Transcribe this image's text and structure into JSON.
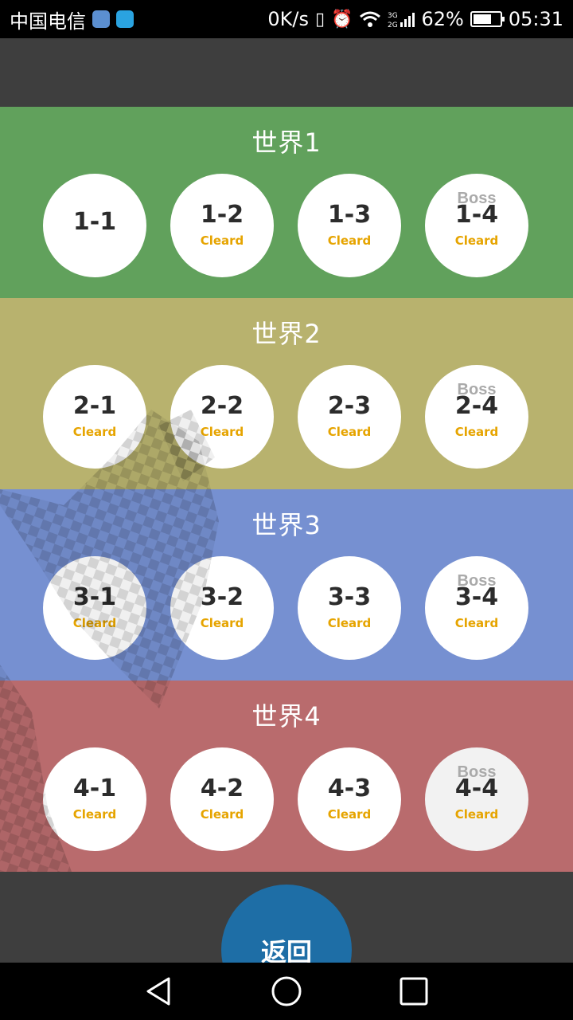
{
  "status_bar": {
    "carrier": "中国电信",
    "net_speed": "0K/s",
    "network": "3G 2G",
    "battery": "62%",
    "time": "05:31",
    "icons": [
      "app-icon",
      "app-icon",
      "vibrate-icon",
      "alarm-icon",
      "wifi-icon",
      "signal-icon",
      "battery-icon"
    ]
  },
  "colors": {
    "world1": "#61a15c",
    "world2": "#b8b26e",
    "world3": "#7690d1",
    "world4": "#b96b6d",
    "cleared_text": "#e6a400",
    "back_button": "#1e6ea6"
  },
  "worlds": [
    {
      "title": "世界1",
      "stages": [
        {
          "label": "1-1",
          "boss": "",
          "status": ""
        },
        {
          "label": "1-2",
          "boss": "",
          "status": "Cleard"
        },
        {
          "label": "1-3",
          "boss": "",
          "status": "Cleard"
        },
        {
          "label": "1-4",
          "boss": "Boss",
          "status": "Cleard"
        }
      ]
    },
    {
      "title": "世界2",
      "stages": [
        {
          "label": "2-1",
          "boss": "",
          "status": "Cleard"
        },
        {
          "label": "2-2",
          "boss": "",
          "status": "Cleard"
        },
        {
          "label": "2-3",
          "boss": "",
          "status": "Cleard"
        },
        {
          "label": "2-4",
          "boss": "Boss",
          "status": "Cleard"
        }
      ]
    },
    {
      "title": "世界3",
      "stages": [
        {
          "label": "3-1",
          "boss": "",
          "status": "Cleard"
        },
        {
          "label": "3-2",
          "boss": "",
          "status": "Cleard"
        },
        {
          "label": "3-3",
          "boss": "",
          "status": "Cleard"
        },
        {
          "label": "3-4",
          "boss": "Boss",
          "status": "Cleard"
        }
      ]
    },
    {
      "title": "世界4",
      "stages": [
        {
          "label": "4-1",
          "boss": "",
          "status": "Cleard"
        },
        {
          "label": "4-2",
          "boss": "",
          "status": "Cleard"
        },
        {
          "label": "4-3",
          "boss": "",
          "status": "Cleard"
        },
        {
          "label": "4-4",
          "boss": "Boss",
          "status": "Cleard"
        }
      ]
    }
  ],
  "back_button": {
    "label": "返回"
  },
  "nav_bar": {
    "icons": [
      "back-triangle-icon",
      "home-circle-icon",
      "recents-square-icon"
    ]
  }
}
